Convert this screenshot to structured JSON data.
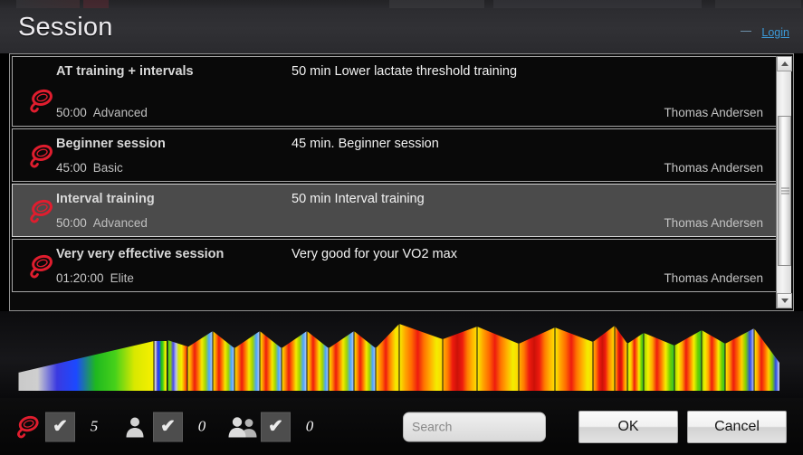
{
  "header": {
    "title": "Session",
    "minimize_icon": "minimize-dash-icon",
    "login_label": "Login"
  },
  "colors": {
    "accent_link": "#3c9ad8",
    "logo_red": "#e01d2e",
    "selected_row_bg": "#4b4b4b",
    "panel_border": "#8e8e8e",
    "row_border": "#a6a6a6",
    "header_bg": "#2e2e32",
    "page_bg": "#000000"
  },
  "list": {
    "icon_name": "session-lasso-icon",
    "selected_index": 2,
    "rows": [
      {
        "title": "AT training + intervals",
        "description": "50 min Lower lactate threshold training",
        "duration": "50:00",
        "level": "Advanced",
        "author": "Thomas Andersen",
        "selected": false,
        "tall": true
      },
      {
        "title": "Beginner session",
        "description": "45 min. Beginner session",
        "duration": "45:00",
        "level": "Basic",
        "author": "Thomas Andersen",
        "selected": false,
        "tall": false
      },
      {
        "title": "Interval training",
        "description": "50 min Interval training",
        "duration": "50:00",
        "level": "Advanced",
        "author": "Thomas Andersen",
        "selected": true,
        "tall": false
      },
      {
        "title": "Very very effective session",
        "description": "Very good for your VO2 max",
        "duration": "01:20:00",
        "level": "Elite",
        "author": "Thomas Andersen",
        "selected": false,
        "tall": false
      }
    ]
  },
  "scrollbar": {
    "up_icon": "scroll-up-arrow-icon",
    "down_icon": "scroll-down-arrow-icon",
    "thumb_name": "scrollbar-thumb",
    "grip_icon": "grip-lines-icon"
  },
  "profile_graphic": {
    "name": "training-intensity-profile",
    "description": "Rainbow-gradient heart-rate zone intensity profile bars"
  },
  "bottombar": {
    "counters": [
      {
        "icon": "session-lasso-icon",
        "checked": true,
        "check_glyph": "✔",
        "count": "5"
      },
      {
        "icon": "person-icon",
        "checked": true,
        "check_glyph": "✔",
        "count": "0"
      },
      {
        "icon": "people-group-icon",
        "checked": true,
        "check_glyph": "✔",
        "count": "0"
      }
    ],
    "search": {
      "value": "",
      "placeholder": "Search",
      "name": "search-input"
    },
    "ok_label": "OK",
    "cancel_label": "Cancel"
  }
}
